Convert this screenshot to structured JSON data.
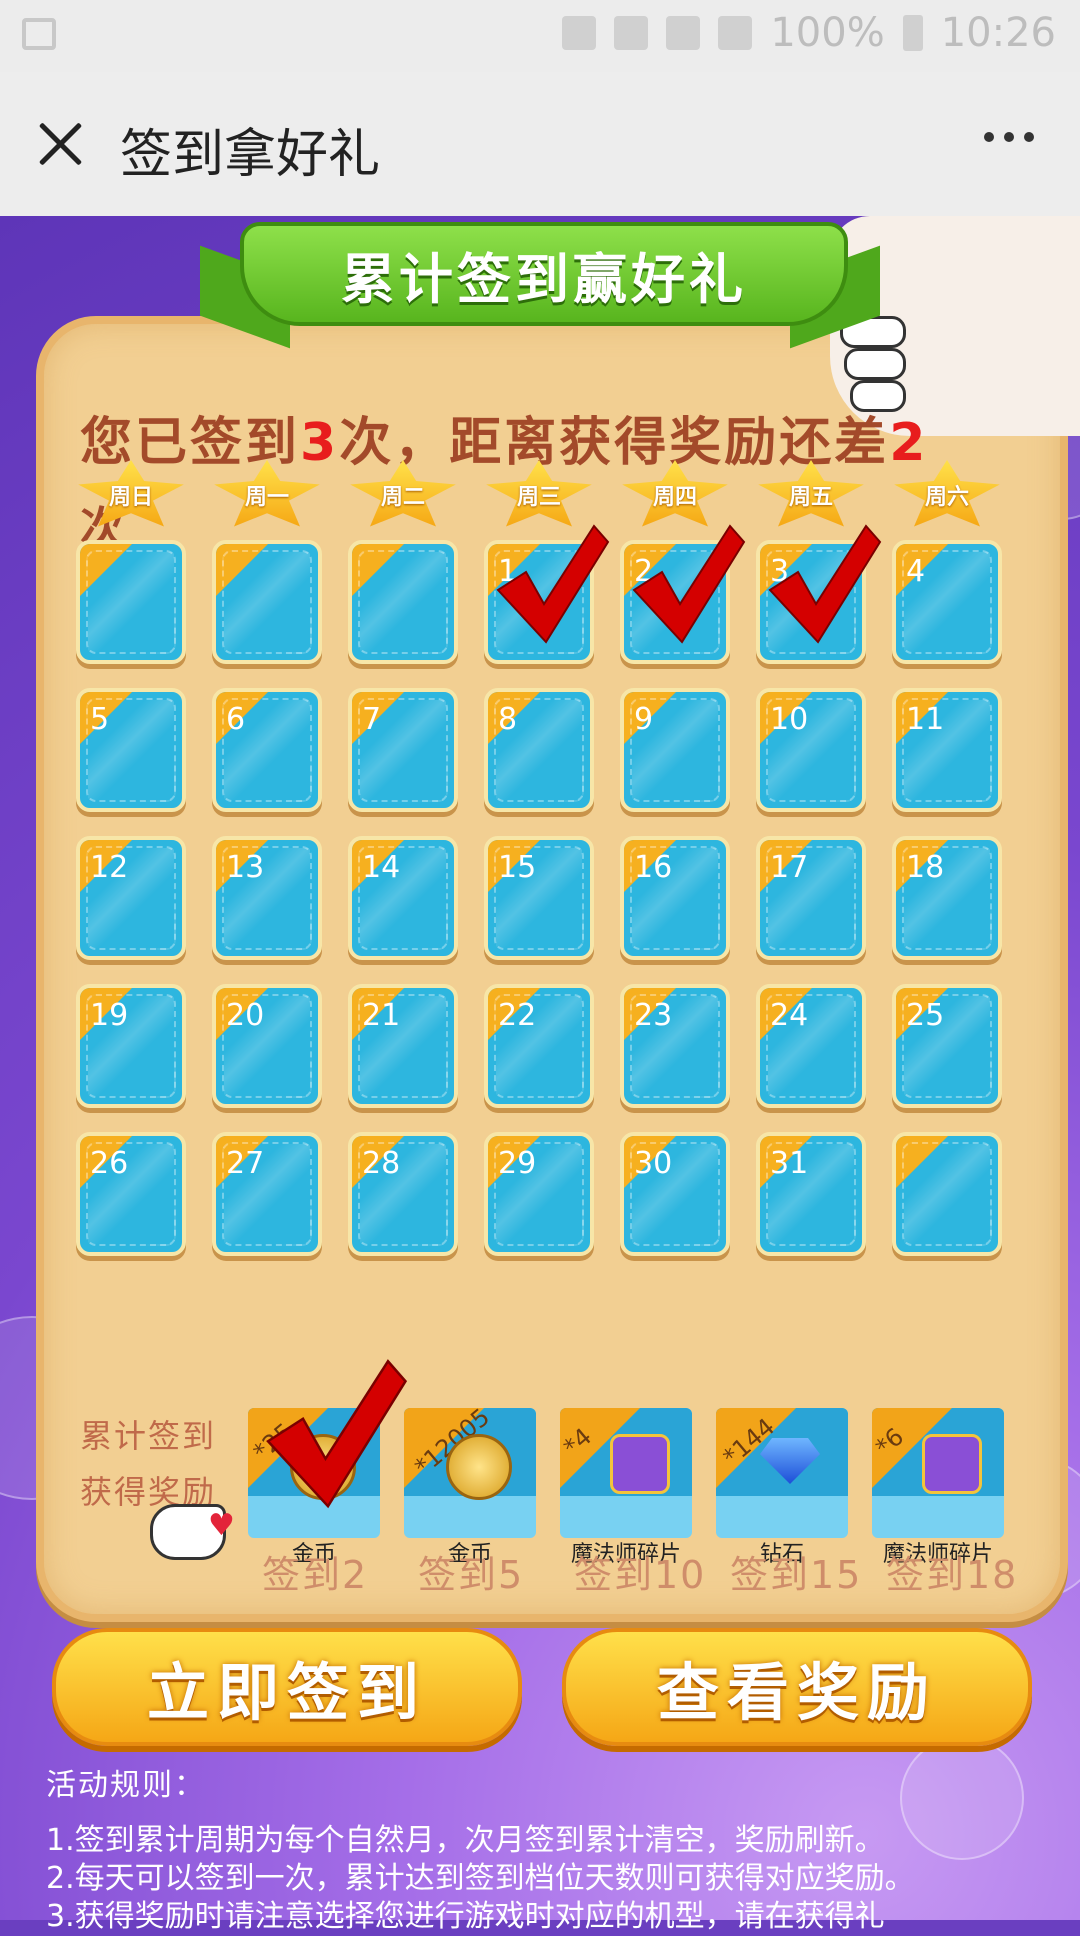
{
  "status_bar": {
    "battery": "100%",
    "time": "10:26"
  },
  "nav": {
    "title": "签到拿好礼"
  },
  "banner": {
    "title": "累计签到赢好礼"
  },
  "status": {
    "prefix": "您已签到",
    "count": "3",
    "middle": "次，距离获得奖励还差",
    "remaining": "2",
    "suffix": "次"
  },
  "weekdays": [
    "周日",
    "周一",
    "周二",
    "周三",
    "周四",
    "周五",
    "周六"
  ],
  "calendar": {
    "days": [
      "",
      "",
      "",
      "1",
      "2",
      "3",
      "4",
      "5",
      "6",
      "7",
      "8",
      "9",
      "10",
      "11",
      "12",
      "13",
      "14",
      "15",
      "16",
      "17",
      "18",
      "19",
      "20",
      "21",
      "22",
      "23",
      "24",
      "25",
      "26",
      "27",
      "28",
      "29",
      "30",
      "31",
      ""
    ],
    "checked": [
      "1",
      "2",
      "3"
    ]
  },
  "rewards": {
    "label_line1": "累计签到",
    "label_line2": "获得奖励",
    "items": [
      {
        "count": "*25",
        "name": "金币",
        "days": "签到2",
        "icon": "coin-icon",
        "claimed": true
      },
      {
        "count": "*12005",
        "name": "金币",
        "days": "签到5",
        "icon": "coin-icon",
        "claimed": false
      },
      {
        "count": "*4",
        "name": "魔法师碎片",
        "days": "签到10",
        "icon": "puzzle-piece-icon",
        "claimed": false
      },
      {
        "count": "*144",
        "name": "钻石",
        "days": "签到15",
        "icon": "diamond-icon",
        "claimed": false
      },
      {
        "count": "*6",
        "name": "魔法师碎片",
        "days": "签到18",
        "icon": "puzzle-piece-icon",
        "claimed": false
      }
    ]
  },
  "buttons": {
    "sign_in": "立即签到",
    "view_rewards": "查看奖励"
  },
  "rules": {
    "title": "活动规则：",
    "lines": [
      "1.签到累计周期为每个自然月，次月签到累计清空，奖励刷新。",
      "2.每天可以签到一次，累计达到签到档位天数则可获得对应奖励。",
      "3.获得奖励时请注意选择您进行游戏时对应的机型，请在获得礼"
    ]
  },
  "colors": {
    "background": "#7a47cf",
    "panel": "#f2cf92",
    "cell": "#2db6df",
    "button": "#f5a716",
    "check": "#d40000"
  }
}
